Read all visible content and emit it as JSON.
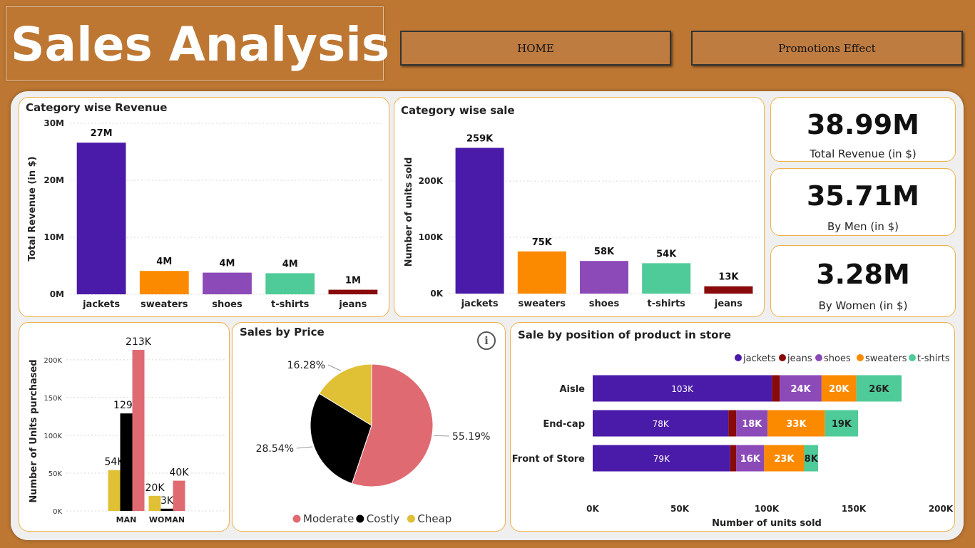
{
  "header": {
    "title": "Sales Analysis",
    "home_label": "HOME",
    "promotions_label": "Promotions Effect"
  },
  "kpis": [
    {
      "value": "38.99M",
      "label": "Total Revenue (in $)"
    },
    {
      "value": "35.71M",
      "label": "By Men (in $)"
    },
    {
      "value": "3.28M",
      "label": "By Women (in $)"
    }
  ],
  "colors": {
    "jackets": "#4a1aa8",
    "sweaters": "#fb8a00",
    "shoes": "#8c4ab8",
    "t-shirts": "#4ecb98",
    "jeans": "#880a0a",
    "moderate": "#e06a72",
    "costly": "#000000",
    "cheap": "#e0c034"
  },
  "chart_data": [
    {
      "id": "revenue",
      "type": "bar",
      "title": "Category wise Revenue",
      "xlabel": "",
      "ylabel": "Total Revenue (in $)",
      "categories": [
        "jackets",
        "sweaters",
        "shoes",
        "t-shirts",
        "jeans"
      ],
      "values": [
        26.6,
        4.1,
        3.8,
        3.7,
        0.8
      ],
      "data_labels": [
        "27M",
        "4M",
        "4M",
        "4M",
        "1M"
      ],
      "ylim": [
        0,
        30
      ],
      "yticks": [
        0,
        10,
        20,
        30
      ],
      "ytick_labels": [
        "0M",
        "10M",
        "20M",
        "30M"
      ],
      "grid": true
    },
    {
      "id": "units",
      "type": "bar",
      "title": "Category wise sale",
      "xlabel": "",
      "ylabel": "Number of units sold",
      "categories": [
        "jackets",
        "sweaters",
        "shoes",
        "t-shirts",
        "jeans"
      ],
      "values": [
        259,
        75,
        58,
        54,
        13
      ],
      "data_labels": [
        "259K",
        "75K",
        "58K",
        "54K",
        "13K"
      ],
      "ylim": [
        0,
        290
      ],
      "yticks": [
        0,
        100,
        200
      ],
      "ytick_labels": [
        "0K",
        "100K",
        "200K"
      ],
      "grid": true
    },
    {
      "id": "gender",
      "type": "bar",
      "title": "",
      "xlabel": "",
      "ylabel": "Number of Units purchased",
      "categories": [
        "MAN",
        "WOMAN"
      ],
      "series": [
        {
          "key": "cheap",
          "values": [
            54,
            20
          ],
          "data_labels": [
            "54K",
            "20K"
          ]
        },
        {
          "key": "costly",
          "values": [
            129,
            3
          ],
          "data_labels": [
            "129K",
            "3K"
          ]
        },
        {
          "key": "moderate",
          "values": [
            213,
            40
          ],
          "data_labels": [
            "213K",
            "40K"
          ]
        }
      ],
      "ylim": [
        0,
        230
      ],
      "yticks": [
        0,
        50,
        100,
        150,
        200
      ],
      "ytick_labels": [
        "0K",
        "50K",
        "100K",
        "150K",
        "200K"
      ],
      "grid": true
    },
    {
      "id": "price",
      "type": "pie",
      "title": "Sales by Price",
      "slices": [
        {
          "key": "moderate",
          "label": "Moderate",
          "value": 55.19,
          "display": "55.19%"
        },
        {
          "key": "costly",
          "label": "Costly",
          "value": 28.54,
          "display": "28.54%"
        },
        {
          "key": "cheap",
          "label": "Cheap",
          "value": 16.28,
          "display": "16.28%"
        }
      ],
      "legend": "bottom"
    },
    {
      "id": "position",
      "type": "bar",
      "orientation": "horizontal-stacked",
      "title": "Sale by position of product in store",
      "xlabel": "Number of units sold",
      "ylabel": "",
      "categories": [
        "Aisle",
        "End-cap",
        "Front of Store"
      ],
      "series": [
        {
          "key": "jackets",
          "name": "jackets",
          "values": [
            103,
            78,
            79
          ],
          "data_labels": [
            "103K",
            "78K",
            "79K"
          ]
        },
        {
          "key": "jeans",
          "name": "jeans",
          "values": [
            4.5,
            4.5,
            3.5
          ],
          "data_labels": [
            "",
            "",
            ""
          ]
        },
        {
          "key": "shoes",
          "name": "shoes",
          "values": [
            24,
            18,
            16
          ],
          "data_labels": [
            "24K",
            "18K",
            "16K"
          ]
        },
        {
          "key": "sweaters",
          "name": "sweaters",
          "values": [
            20,
            33,
            23
          ],
          "data_labels": [
            "20K",
            "33K",
            "23K"
          ]
        },
        {
          "key": "t-shirts",
          "name": "t-shirts",
          "values": [
            26,
            19,
            8
          ],
          "data_labels": [
            "26K",
            "19K",
            "8K"
          ]
        }
      ],
      "xlim": [
        0,
        200
      ],
      "xticks": [
        0,
        50,
        100,
        150,
        200
      ],
      "xtick_labels": [
        "0K",
        "50K",
        "100K",
        "150K",
        "200K"
      ],
      "legend": "top-right"
    }
  ]
}
